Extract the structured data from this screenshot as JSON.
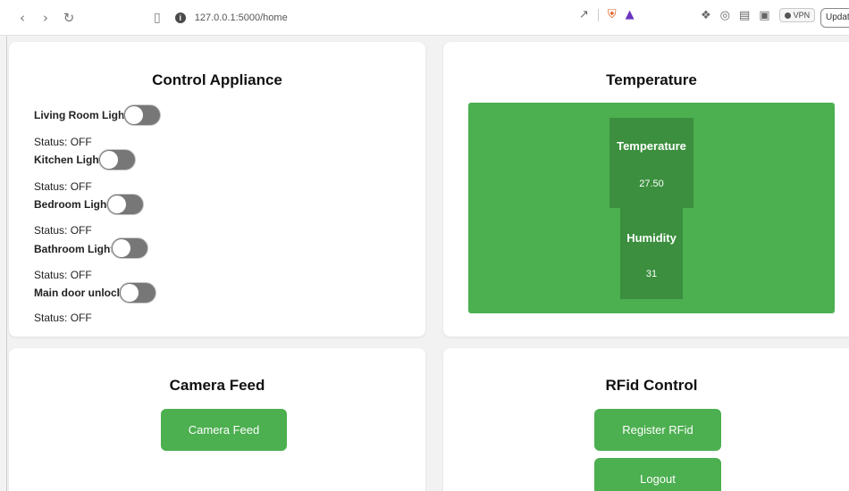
{
  "browser": {
    "url": "127.0.0.1:5000/home",
    "vpn_label": "VPN",
    "update_label": "Update"
  },
  "control": {
    "title": "Control Appliance",
    "appliances": [
      {
        "name": "Living Room Light",
        "status": "Status: OFF"
      },
      {
        "name": "Kitchen Light",
        "status": "Status: OFF"
      },
      {
        "name": "Bedroom Light",
        "status": "Status: OFF"
      },
      {
        "name": "Bathroom Light",
        "status": "Status: OFF"
      },
      {
        "name": "Main door unlock",
        "status": "Status: OFF"
      }
    ]
  },
  "temperature": {
    "title": "Temperature",
    "temp_label": "Temperature",
    "temp_value": "27.50",
    "humidity_label": "Humidity",
    "humidity_value": "31"
  },
  "camera": {
    "title": "Camera Feed",
    "button_label": "Camera Feed"
  },
  "rfid": {
    "title": "RFid Control",
    "register_label": "Register RFid",
    "logout_label": "Logout"
  },
  "colors": {
    "accent_green": "#4caf50",
    "dark_green": "#3b8f3e",
    "toggle_off": "#777777"
  }
}
